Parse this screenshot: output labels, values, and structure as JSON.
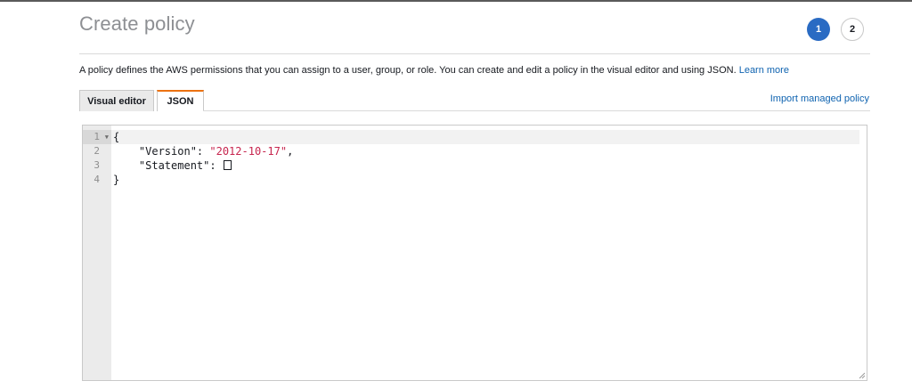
{
  "header": {
    "title": "Create policy",
    "steps": [
      "1",
      "2"
    ]
  },
  "description": {
    "text": "A policy defines the AWS permissions that you can assign to a user, group, or role. You can create and edit a policy in the visual editor and using JSON.",
    "learn_more": "Learn more"
  },
  "tabs": [
    {
      "label": "Visual editor",
      "active": false
    },
    {
      "label": "JSON",
      "active": true
    }
  ],
  "import_link": "Import managed policy",
  "editor": {
    "line_numbers": [
      "1",
      "2",
      "3",
      "4"
    ],
    "lines": {
      "l1": "{",
      "l2_key": "    \"Version\": ",
      "l2_val": "\"2012-10-17\"",
      "l2_end": ",",
      "l3_key": "    \"Statement\": ",
      "l4": "}"
    }
  },
  "colors": {
    "accent": "#2a6bc3",
    "tab_active": "#ec7211",
    "link": "#0f63b0",
    "string": "#c7254e"
  }
}
